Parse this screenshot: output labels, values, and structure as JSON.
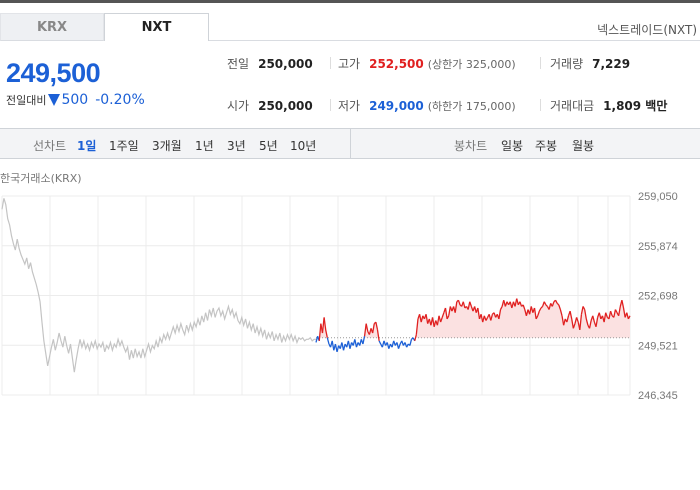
{
  "tabs": [
    {
      "label": "KRX"
    },
    {
      "label": "NXT"
    }
  ],
  "venue": "넥스트레이드(NXT)",
  "price": {
    "current": "249,500",
    "change_label": "전일대비",
    "change_amount": "500",
    "change_pct": "-0.20%",
    "direction": "down"
  },
  "stats": {
    "prev": {
      "label": "전일",
      "value": "250,000"
    },
    "high": {
      "label": "고가",
      "value": "252,500",
      "sub": "(상한가 325,000)"
    },
    "volume": {
      "label": "거래량",
      "value": "7,229"
    },
    "open": {
      "label": "시가",
      "value": "250,000"
    },
    "low": {
      "label": "저가",
      "value": "249,000",
      "sub": "(하한가 175,000)"
    },
    "amount": {
      "label": "거래대금",
      "value": "1,809 백만"
    }
  },
  "line_periods": {
    "label": "선차트",
    "items": [
      "1일",
      "1주일",
      "3개월",
      "1년",
      "3년",
      "5년",
      "10년"
    ],
    "selected": "1일"
  },
  "candle_periods": {
    "label": "봉차트",
    "items": [
      "일봉",
      "주봉",
      "월봉"
    ]
  },
  "exchange_label": "한국거래소(KRX)",
  "colors": {
    "up": "#e02020",
    "down": "#1c60d6",
    "krx_line": "#c4c4c4",
    "up_fill": "#fbe1e1"
  },
  "chart_data": {
    "type": "line",
    "yticks": [
      "259,050",
      "255,874",
      "252,698",
      "249,521",
      "246,345"
    ],
    "ylim": [
      246345,
      259050
    ],
    "reference": 250000,
    "krx_series": [
      258200,
      258900,
      258500,
      257600,
      257200,
      256500,
      256000,
      255600,
      256300,
      255700,
      255300,
      255000,
      254700,
      255100,
      254400,
      254800,
      254200,
      253800,
      253400,
      252900,
      252300,
      251000,
      249800,
      249000,
      248200,
      248800,
      249400,
      249900,
      249200,
      249700,
      250300,
      249800,
      249400,
      250100,
      249500,
      249000,
      249600,
      248700,
      247800,
      248600,
      249300,
      249900,
      249400,
      249800,
      249300,
      249600,
      249200,
      249700,
      249400,
      249800,
      249300,
      249600,
      249400,
      249700,
      249100,
      249500,
      249300,
      249700,
      249200,
      249600,
      249400,
      249900,
      249500,
      249800,
      249400,
      249100,
      249400,
      248600,
      249200,
      248700,
      249300,
      248800,
      249100,
      248700,
      249300,
      248800,
      249200,
      249600,
      249100,
      249500,
      249300,
      249800,
      249400,
      250000,
      249700,
      250200,
      249900,
      250300,
      249900,
      250300,
      250700,
      250300,
      250800,
      250400,
      250900,
      250500,
      250200,
      250800,
      250400,
      250900,
      250500,
      251000,
      250700,
      251200,
      250800,
      251400,
      251000,
      251600,
      251100,
      251800,
      251400,
      251900,
      251300,
      251700,
      251900,
      251400,
      251700,
      251200,
      251600,
      252000,
      251500,
      251800,
      251300,
      251600,
      251100,
      250900,
      251300,
      250800,
      251200,
      250600,
      251000,
      250500,
      250900,
      250300,
      250700,
      250200,
      250600,
      250100,
      250500,
      249900,
      250300,
      250000,
      250400,
      249800,
      250200,
      249900,
      250300,
      249700,
      250100,
      249800,
      250200,
      249900,
      250200,
      249800,
      250100,
      249700,
      250000,
      249900,
      250000,
      249800,
      249900,
      249900,
      250000,
      249800,
      249900,
      249900
    ],
    "nxt_series": [
      249700,
      250100,
      249800,
      250900,
      250300,
      251300,
      250500,
      250000,
      249600,
      249400,
      249800,
      249200,
      249600,
      249100,
      249500,
      249300,
      249700,
      249200,
      249600,
      249400,
      249800,
      249300,
      249700,
      249500,
      249900,
      249400,
      249700,
      249500,
      249900,
      249600,
      250100,
      250900,
      250400,
      250200,
      250600,
      250300,
      250900,
      251000,
      250500,
      249800,
      249600,
      249400,
      249800,
      249500,
      249700,
      249300,
      249600,
      249400,
      249800,
      249500,
      249700,
      249300,
      249600,
      249800,
      249500,
      249700,
      249400,
      249600,
      249500,
      249900,
      250000,
      249800,
      250200,
      251200,
      251500,
      251000,
      251400,
      251200,
      251500,
      250900,
      251200,
      250800,
      251300,
      250700,
      251100,
      250800,
      251400,
      251000,
      251300,
      251600,
      251900,
      251200,
      251400,
      252000,
      251700,
      252000,
      251600,
      252300,
      252400,
      252100,
      252000,
      252300,
      251900,
      252000,
      251800,
      252300,
      252000,
      251700,
      252000,
      251600,
      251900,
      251200,
      251500,
      251000,
      251400,
      251100,
      251300,
      251500,
      251100,
      251500,
      251600,
      251300,
      251500,
      251200,
      251800,
      252000,
      252400,
      252000,
      252300,
      252100,
      252300,
      251900,
      252300,
      252000,
      252500,
      252100,
      252300,
      252000,
      252100,
      251800,
      251400,
      251800,
      251500,
      252000,
      251600,
      251900,
      251200,
      251400,
      251700,
      251900,
      252000,
      252300,
      252100,
      252000,
      251800,
      252200,
      252000,
      252300,
      252400,
      252200,
      252100,
      251800,
      251400,
      250800,
      251200,
      251000,
      251400,
      251700,
      251200,
      250600,
      250900,
      251300,
      251000,
      250500,
      251500,
      252000,
      251800,
      251200,
      250800,
      250600,
      251100,
      251400,
      251000,
      250700,
      251300,
      251600,
      251200,
      251400,
      251000,
      251600,
      251300,
      251200,
      251700,
      251400,
      251300,
      251800,
      251600,
      251400,
      252000,
      252400,
      251900,
      251300,
      251600,
      251200,
      251400
    ]
  }
}
